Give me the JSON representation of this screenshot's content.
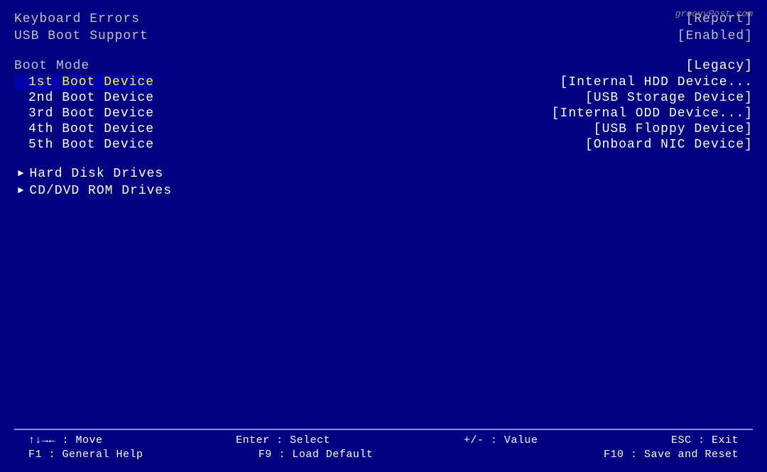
{
  "watermark": "groovyPost.com",
  "bios": {
    "rows_top": [
      {
        "label": "Keyboard Errors",
        "value": "[Report]"
      },
      {
        "label": "USB Boot Support",
        "value": "[Enabled]"
      }
    ],
    "boot_mode": {
      "label": "Boot Mode",
      "value": "[Legacy]"
    },
    "boot_devices": [
      {
        "label": "1st Boot Device",
        "value": "[Internal HDD Device...",
        "selected": true
      },
      {
        "label": "2nd Boot Device",
        "value": "[USB Storage Device]",
        "selected": false
      },
      {
        "label": "3rd Boot Device",
        "value": "[Internal ODD Device...]",
        "selected": false
      },
      {
        "label": "4th Boot Device",
        "value": "[USB Floppy Device]",
        "selected": false
      },
      {
        "label": "5th Boot Device",
        "value": "[Onboard NIC Device]",
        "selected": false
      }
    ],
    "submenus": [
      {
        "label": "Hard Disk Drives"
      },
      {
        "label": "CD/DVD ROM Drives"
      }
    ]
  },
  "footer": {
    "row1": [
      {
        "key": "↑↓→← : Move",
        "sep": ""
      },
      {
        "key": "Enter : Select",
        "sep": ""
      },
      {
        "key": "+/- : Value",
        "sep": ""
      },
      {
        "key": "ESC : Exit",
        "sep": ""
      }
    ],
    "row2": [
      {
        "key": "F1 : General Help",
        "sep": ""
      },
      {
        "key": "F9 : Load Default",
        "sep": ""
      },
      {
        "key": "",
        "sep": ""
      },
      {
        "key": "F10 : Save and Reset",
        "sep": ""
      }
    ]
  }
}
